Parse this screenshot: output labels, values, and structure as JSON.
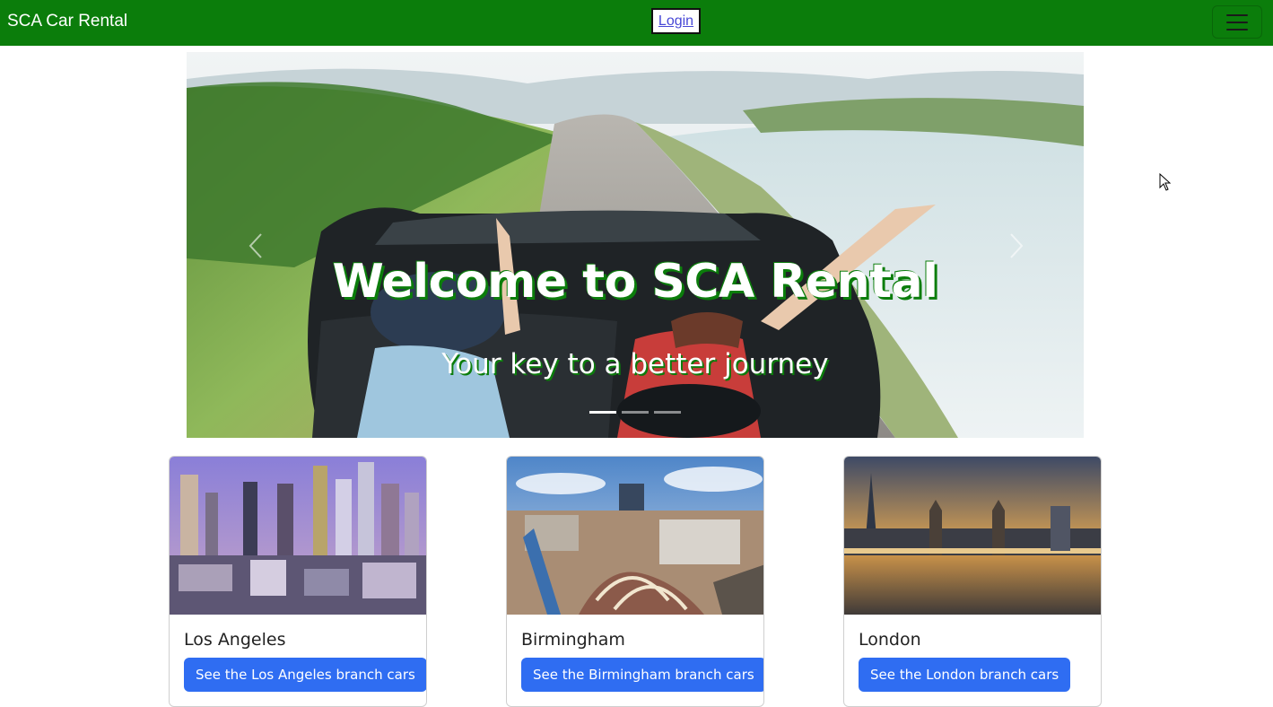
{
  "navbar": {
    "brand": "SCA Car Rental",
    "login_label": "Login",
    "menu_icon": "hamburger-menu-icon",
    "background_color": "#0b7d0b"
  },
  "hero": {
    "title": "Welcome to SCA Rental",
    "subtitle": "Your key to a better journey",
    "slide_count": 3,
    "active_slide": 1,
    "prev_icon": "chevron-left-icon",
    "next_icon": "chevron-right-icon",
    "text_shadow_color": "#0b7d0b"
  },
  "branches": [
    {
      "city": "Los Angeles",
      "button_label": "See the Los Angeles branch cars"
    },
    {
      "city": "Birmingham",
      "button_label": "See the Birmingham branch cars"
    },
    {
      "city": "London",
      "button_label": "See the London branch cars"
    }
  ],
  "colors": {
    "button": "#2f6df2",
    "card_border": "#cfcfcf"
  }
}
